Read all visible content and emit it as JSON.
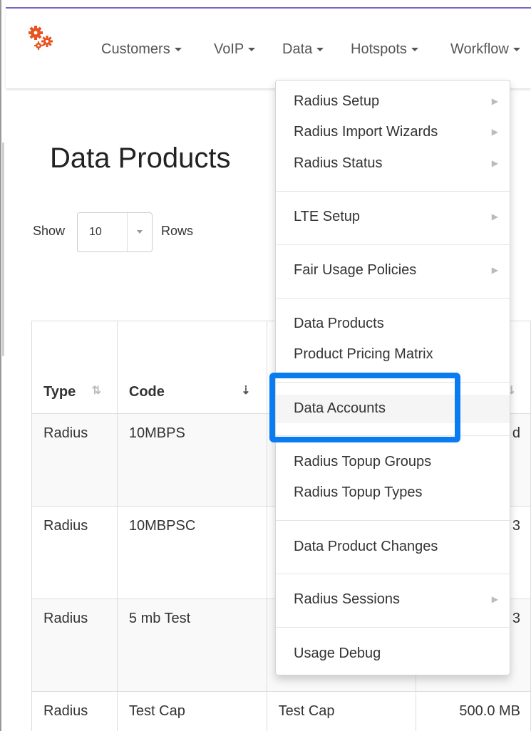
{
  "colors": {
    "accent_top": "#7b62c9",
    "focus_highlight": "#0a7cf2",
    "logo": "#e8531f"
  },
  "logo": {
    "icon": "gears-icon"
  },
  "nav": {
    "items": [
      {
        "label": "Customers"
      },
      {
        "label": "VoIP"
      },
      {
        "label": "Data"
      },
      {
        "label": "Hotspots"
      },
      {
        "label": "Workflow"
      }
    ]
  },
  "page": {
    "title": "Data Products"
  },
  "pagination": {
    "show_label": "Show",
    "rows_value": "10",
    "rows_label": "Rows"
  },
  "table": {
    "headers": [
      "Type",
      "Code",
      "",
      ""
    ],
    "rows": [
      [
        "Radius",
        "10MBPS",
        "",
        "d"
      ],
      [
        "Radius",
        "10MBPSC",
        "",
        "3"
      ],
      [
        "Radius",
        "5 mb Test",
        "",
        "3"
      ],
      [
        "Radius",
        "Test Cap",
        "Test Cap",
        "500.0 MB"
      ]
    ]
  },
  "dropdown": {
    "items": [
      {
        "label": "Radius Setup",
        "has_submenu": true
      },
      {
        "label": "Radius Import Wizards",
        "has_submenu": true
      },
      {
        "label": "Radius Status",
        "has_submenu": true
      },
      {
        "label": "LTE Setup",
        "has_submenu": true
      },
      {
        "label": "Fair Usage Policies",
        "has_submenu": true
      },
      {
        "label": "Data Products",
        "has_submenu": false
      },
      {
        "label": "Product Pricing Matrix",
        "has_submenu": false
      },
      {
        "label": "Data Accounts",
        "has_submenu": false
      },
      {
        "label": "Radius Topup Groups",
        "has_submenu": false
      },
      {
        "label": "Radius Topup Types",
        "has_submenu": false
      },
      {
        "label": "Data Product Changes",
        "has_submenu": false
      },
      {
        "label": "Radius Sessions",
        "has_submenu": true
      },
      {
        "label": "Usage Debug",
        "has_submenu": false
      }
    ]
  }
}
